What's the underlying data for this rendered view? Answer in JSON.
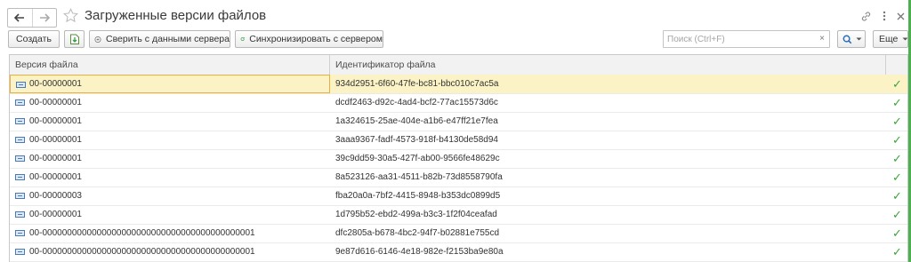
{
  "window": {
    "title": "Загруженные версии файлов"
  },
  "icons": {
    "back": "arrow-left-icon",
    "forward": "arrow-right-icon",
    "favorite": "star-icon",
    "link": "link-icon",
    "more": "more-vertical-icon",
    "close": "close-icon",
    "save_file": "save-file-icon",
    "compare": "compare-icon",
    "sync": "refresh-icon",
    "search": "search-icon",
    "row": "file-version-icon",
    "status": "checkmark-icon"
  },
  "toolbar": {
    "create_label": "Создать",
    "compare_label": "Сверить с данными сервера",
    "sync_label": "Синхронизировать с сервером",
    "more_label": "Еще",
    "search_placeholder": "Поиск (Ctrl+F)",
    "search_value": "",
    "clear_symbol": "×"
  },
  "table": {
    "columns": [
      "Версия файла",
      "Идентификатор файла",
      ""
    ],
    "rows": [
      {
        "version": "00-00000001",
        "id": "934d2951-6f60-47fe-bc81-bbc010c7ac5a",
        "ok": true,
        "selected": true
      },
      {
        "version": "00-00000001",
        "id": "dcdf2463-d92c-4ad4-bcf2-77ac15573d6c",
        "ok": true
      },
      {
        "version": "00-00000001",
        "id": "1a324615-25ae-404e-a1b6-e47ff21e7fea",
        "ok": true
      },
      {
        "version": "00-00000001",
        "id": "3aaa9367-fadf-4573-918f-b4130de58d94",
        "ok": true
      },
      {
        "version": "00-00000001",
        "id": "39c9dd59-30a5-427f-ab00-9566fe48629c",
        "ok": true
      },
      {
        "version": "00-00000001",
        "id": "8a523126-aa31-4511-b82b-73d8558790fa",
        "ok": true
      },
      {
        "version": "00-00000003",
        "id": "fba20a0a-7bf2-4415-8948-b353dc0899d5",
        "ok": true
      },
      {
        "version": "00-00000001",
        "id": "1d795b52-ebd2-499a-b3c3-1f2f04ceafad",
        "ok": true
      },
      {
        "version": "00-0000000000000000000000000000000000000000001",
        "id": "dfc2805a-b678-4bc2-94f7-b02881e755cd",
        "ok": true
      },
      {
        "version": "00-0000000000000000000000000000000000000000001",
        "id": "9e87d616-6146-4e18-982e-f2153ba9e80a",
        "ok": true
      }
    ],
    "check_symbol": "✓"
  },
  "colors": {
    "selected_row": "#fbf3c6",
    "selected_border": "#e8b13a",
    "check_green": "#3aa53a",
    "accent_bar": "#4caf50",
    "sync_icon": "#2f9e44"
  }
}
